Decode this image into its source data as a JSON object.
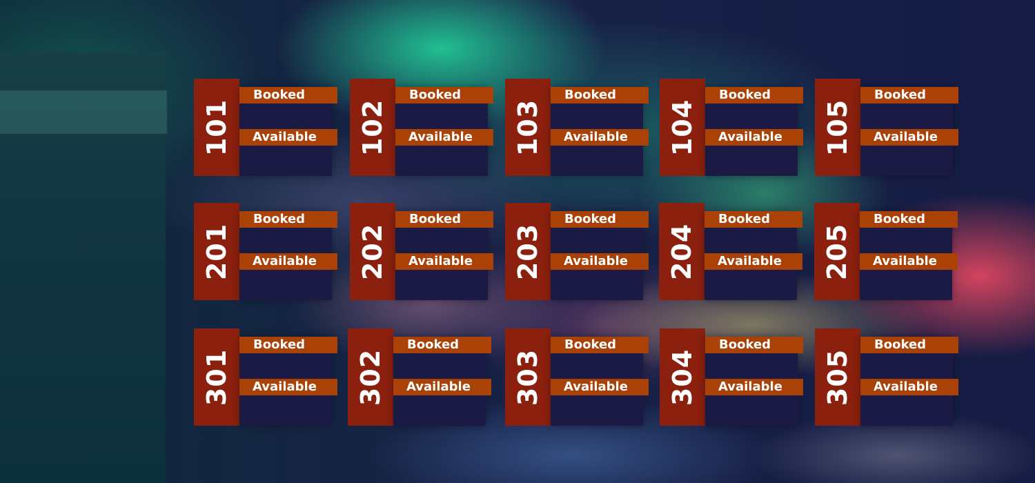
{
  "colors": {
    "room_number_bg": "#8b200e",
    "status_bar": "#aa4208",
    "card_panel": "#1a1a45",
    "left_panel": "#113540"
  },
  "status_labels": {
    "booked": "Booked",
    "available": "Available"
  },
  "floors": [
    {
      "rooms": [
        {
          "number": "101"
        },
        {
          "number": "102"
        },
        {
          "number": "103"
        },
        {
          "number": "104"
        },
        {
          "number": "105"
        }
      ]
    },
    {
      "rooms": [
        {
          "number": "201"
        },
        {
          "number": "202"
        },
        {
          "number": "203"
        },
        {
          "number": "204"
        },
        {
          "number": "205"
        }
      ]
    },
    {
      "rooms": [
        {
          "number": "301"
        },
        {
          "number": "302"
        },
        {
          "number": "303"
        },
        {
          "number": "304"
        },
        {
          "number": "305"
        }
      ]
    }
  ]
}
